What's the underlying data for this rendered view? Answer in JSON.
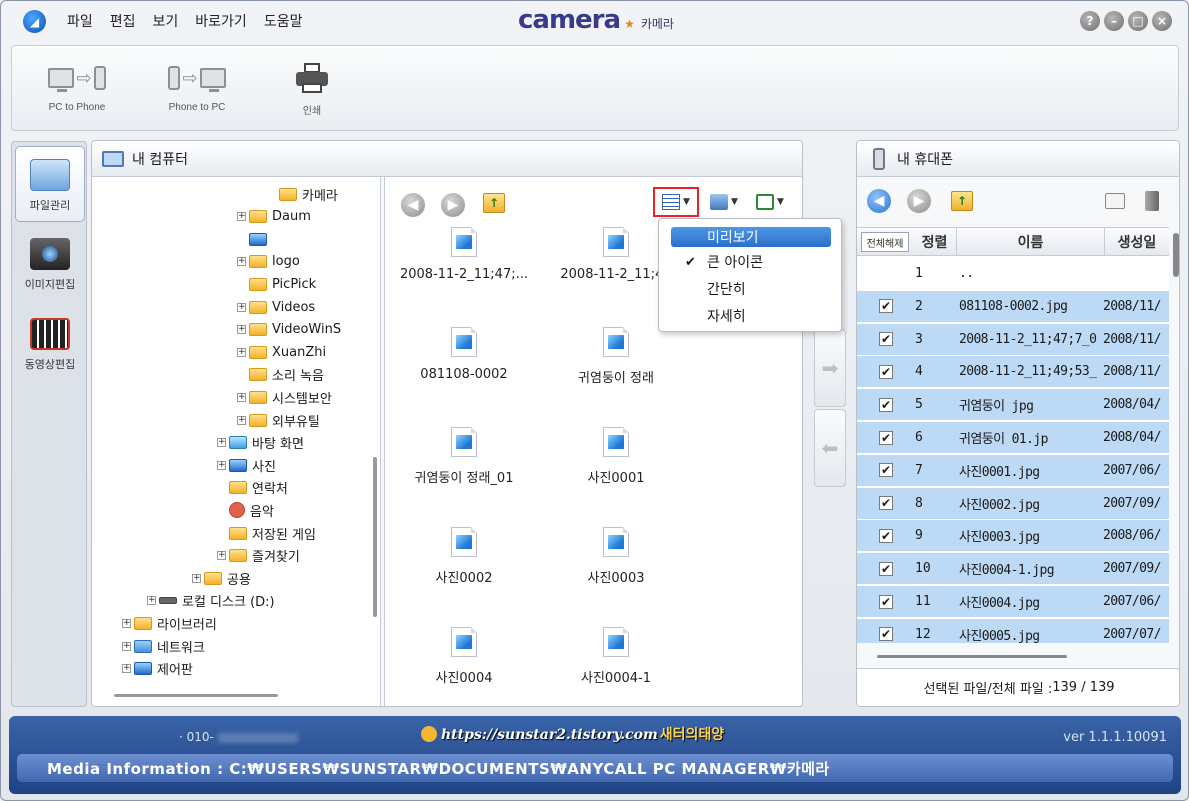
{
  "menu": [
    "파일",
    "편집",
    "보기",
    "바로가기",
    "도움말"
  ],
  "brand": {
    "word": "camera",
    "sub": "카메라",
    "star": "★"
  },
  "window_controls": [
    "?",
    "–",
    "□",
    "×"
  ],
  "toolbar": {
    "pc_to_phone": "PC to Phone",
    "phone_to_pc": "Phone to PC",
    "print": "인쇄"
  },
  "left_tabs": [
    {
      "label": "파일관리",
      "icon": "folder-icon",
      "active": true
    },
    {
      "label": "이미지편집",
      "icon": "camera-icon",
      "active": false
    },
    {
      "label": "동영상편집",
      "icon": "film-icon",
      "active": false
    }
  ],
  "pc_panel": {
    "title": "내 컴퓨터",
    "tree": [
      {
        "label": "카메라",
        "type": "folder",
        "expander": false
      },
      {
        "label": "Daum",
        "type": "folder",
        "expander": true
      },
      {
        "label": "",
        "type": "pic",
        "expander": false
      },
      {
        "label": "logo",
        "type": "folder",
        "expander": true
      },
      {
        "label": "PicPick",
        "type": "folder",
        "expander": false
      },
      {
        "label": "Videos",
        "type": "folder",
        "expander": true
      },
      {
        "label": "VideoWinS",
        "type": "folder",
        "expander": true
      },
      {
        "label": "XuanZhi",
        "type": "folder",
        "expander": true
      },
      {
        "label": "소리 녹음",
        "type": "folder",
        "expander": false
      },
      {
        "label": "시스템보안",
        "type": "folder",
        "expander": true
      },
      {
        "label": "외부유틸",
        "type": "folder",
        "expander": true
      },
      {
        "label": "바탕 화면",
        "type": "blue",
        "expander": true
      },
      {
        "label": "사진",
        "type": "pic",
        "expander": true
      },
      {
        "label": "연락처",
        "type": "folder",
        "expander": false
      },
      {
        "label": "음악",
        "type": "music",
        "expander": false
      },
      {
        "label": "저장된 게임",
        "type": "folder",
        "expander": false
      },
      {
        "label": "즐겨찾기",
        "type": "folder",
        "expander": true
      },
      {
        "label": "공용",
        "type": "folder",
        "expander": true
      },
      {
        "label": "로컬 디스크 (D:)",
        "type": "drive",
        "expander": true
      },
      {
        "label": "라이브러리",
        "type": "folder",
        "expander": true
      },
      {
        "label": "네트워크",
        "type": "net",
        "expander": true
      },
      {
        "label": "제어판",
        "type": "pic",
        "expander": true
      }
    ],
    "files": [
      "2008-11-2_11;47;...",
      "2008-11-2_11;49",
      "081108-0002",
      "귀염둥이 정래",
      "귀염둥이 정래_01",
      "사진0001",
      "사진0002",
      "사진0003",
      "사진0004",
      "사진0004-1"
    ]
  },
  "view_menu": {
    "items": [
      "미리보기",
      "큰 아이콘",
      "간단히",
      "자세히"
    ],
    "highlighted": "미리보기",
    "checked": "큰 아이콘",
    "check_mark": "✔"
  },
  "phone_panel": {
    "title": "내 휴대폰",
    "columns": {
      "select_all": "전체해제",
      "sort": "정렬",
      "name": "이름",
      "date": "생성일"
    },
    "rows": [
      {
        "checked": false,
        "num": "1",
        "name": "..",
        "date": "",
        "sel": false
      },
      {
        "checked": true,
        "num": "2",
        "name": "081108-0002.jpg",
        "date": "2008/11/",
        "sel": true
      },
      {
        "checked": true,
        "num": "3",
        "name": "2008-11-2_11;47;7_0",
        "date": "2008/11/",
        "sel": true
      },
      {
        "checked": true,
        "num": "4",
        "name": "2008-11-2_11;49;53_",
        "date": "2008/11/",
        "sel": true
      },
      {
        "checked": true,
        "num": "5",
        "name": "귀염둥이 jpg",
        "date": "2008/04/",
        "sel": true,
        "blur": true
      },
      {
        "checked": true,
        "num": "6",
        "name": "귀염둥이 01.jp",
        "date": "2008/04/",
        "sel": true,
        "blur": true
      },
      {
        "checked": true,
        "num": "7",
        "name": "사진0001.jpg",
        "date": "2007/06/",
        "sel": true
      },
      {
        "checked": true,
        "num": "8",
        "name": "사진0002.jpg",
        "date": "2007/09/",
        "sel": true
      },
      {
        "checked": true,
        "num": "9",
        "name": "사진0003.jpg",
        "date": "2008/06/",
        "sel": true
      },
      {
        "checked": true,
        "num": "10",
        "name": "사진0004-1.jpg",
        "date": "2007/09/",
        "sel": true
      },
      {
        "checked": true,
        "num": "11",
        "name": "사진0004.jpg",
        "date": "2007/06/",
        "sel": true
      },
      {
        "checked": true,
        "num": "12",
        "name": "사진0005.jpg",
        "date": "2007/07/",
        "sel": true
      }
    ],
    "status_label": "선택된 파일/전체 파일 : ",
    "status_value": "139 / 139"
  },
  "footer": {
    "phone_prefix": "010-",
    "url": "https://sunstar2.tistory.com",
    "site_name": "새터의태양",
    "version": "ver 1.1.1.10091",
    "media_info": "Media Information :  C:₩USERS₩SUNSTAR₩DOCUMENTS₩ANYCALL PC MANAGER₩카메라"
  }
}
